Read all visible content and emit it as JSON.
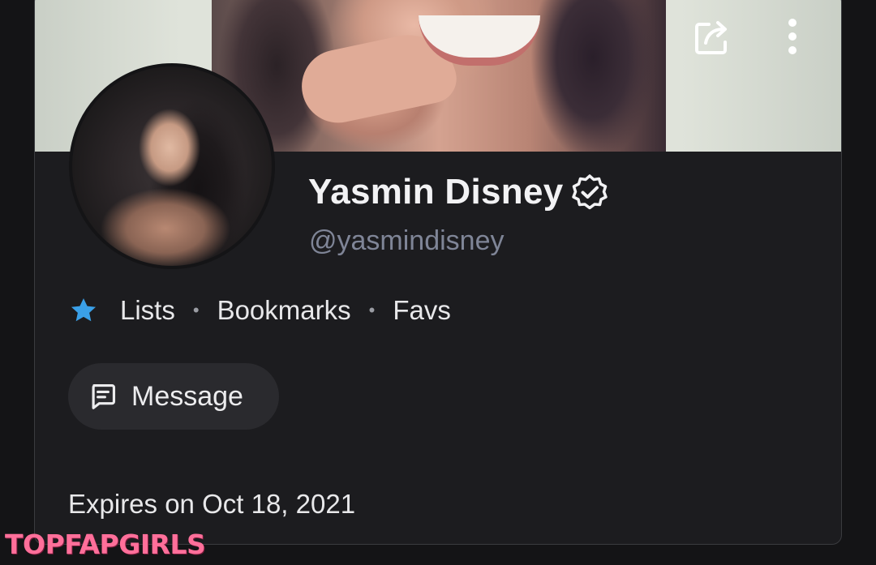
{
  "profile": {
    "name": "Yasmin Disney",
    "handle": "@yasmindisney",
    "verified": true
  },
  "header": {
    "share_icon": "share-icon",
    "more_icon": "more-vertical-icon"
  },
  "links": {
    "lists": "Lists",
    "separator": "•",
    "bookmarks": "Bookmarks",
    "favs": "Favs",
    "star_icon": "star-icon",
    "star_color": "#3aa0e8"
  },
  "actions": {
    "message_label": "Message",
    "message_icon": "message-icon"
  },
  "subscription": {
    "expires": "Expires on Oct 18, 2021"
  },
  "watermark": "TOPFAPGIRLS",
  "colors": {
    "background": "#141416",
    "card": "#1c1c1f",
    "handle": "#7f8597",
    "button": "#2a2a2e",
    "watermark": "#ff6f9a"
  }
}
